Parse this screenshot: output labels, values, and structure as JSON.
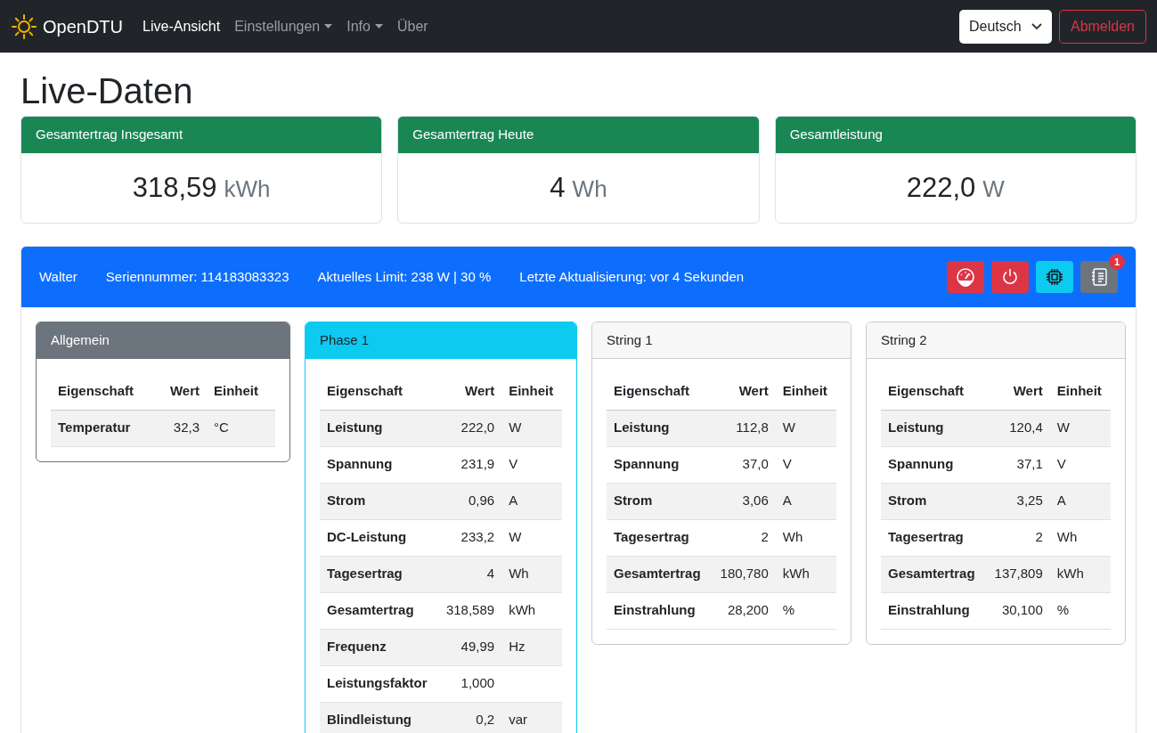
{
  "navbar": {
    "brand": "OpenDTU",
    "items": [
      {
        "label": "Live-Ansicht",
        "selected": true,
        "dropdown": false
      },
      {
        "label": "Einstellungen",
        "selected": false,
        "dropdown": true
      },
      {
        "label": "Info",
        "selected": false,
        "dropdown": true
      },
      {
        "label": "Über",
        "selected": false,
        "dropdown": false
      }
    ],
    "language": "Deutsch",
    "logout": "Abmelden"
  },
  "title": "Live-Daten",
  "totals": [
    {
      "label": "Gesamtertrag Insgesamt",
      "value": "318,59",
      "unit": "kWh"
    },
    {
      "label": "Gesamtertrag Heute",
      "value": "4",
      "unit": "Wh"
    },
    {
      "label": "Gesamtleistung",
      "value": "222,0",
      "unit": "W"
    }
  ],
  "inverter": {
    "name": "Walter",
    "serial": "Seriennummer: 114183083323",
    "limit": "Aktuelles Limit: 238 W | 30 %",
    "updated": "Letzte Aktualisierung: vor 4 Sekunden",
    "buttons": [
      {
        "kind": "gauge"
      },
      {
        "kind": "power"
      },
      {
        "kind": "chip"
      },
      {
        "kind": "log",
        "badge": "1"
      }
    ],
    "cards": [
      {
        "kind": "general",
        "title": "Allgemein",
        "columns": [
          "Eigenschaft",
          "Wert",
          "Einheit"
        ],
        "rows": [
          [
            "Temperatur",
            "32,3",
            "°C"
          ]
        ]
      },
      {
        "kind": "phase",
        "title": "Phase 1",
        "columns": [
          "Eigenschaft",
          "Wert",
          "Einheit"
        ],
        "rows": [
          [
            "Leistung",
            "222,0",
            "W"
          ],
          [
            "Spannung",
            "231,9",
            "V"
          ],
          [
            "Strom",
            "0,96",
            "A"
          ],
          [
            "DC-Leistung",
            "233,2",
            "W"
          ],
          [
            "Tagesertrag",
            "4",
            "Wh"
          ],
          [
            "Gesamtertrag",
            "318,589",
            "kWh"
          ],
          [
            "Frequenz",
            "49,99",
            "Hz"
          ],
          [
            "Leistungsfaktor",
            "1,000"
          ],
          [
            "Blindleistung",
            "0,2",
            "var"
          ]
        ]
      },
      {
        "kind": "string",
        "title": "String 1",
        "columns": [
          "Eigenschaft",
          "Wert",
          "Einheit"
        ],
        "rows": [
          [
            "Leistung",
            "112,8",
            "W"
          ],
          [
            "Spannung",
            "37,0",
            "V"
          ],
          [
            "Strom",
            "3,06",
            "A"
          ],
          [
            "Tagesertrag",
            "2",
            "Wh"
          ],
          [
            "Gesamtertrag",
            "180,780",
            "kWh"
          ],
          [
            "Einstrahlung",
            "28,200",
            "%"
          ]
        ]
      },
      {
        "kind": "string",
        "title": "String 2",
        "columns": [
          "Eigenschaft",
          "Wert",
          "Einheit"
        ],
        "rows": [
          [
            "Leistung",
            "120,4",
            "W"
          ],
          [
            "Spannung",
            "37,1",
            "V"
          ],
          [
            "Strom",
            "3,25",
            "A"
          ],
          [
            "Tagesertrag",
            "2",
            "Wh"
          ],
          [
            "Gesamtertrag",
            "137,809",
            "kWh"
          ],
          [
            "Einstrahlung",
            "30,100",
            "%"
          ]
        ]
      }
    ]
  }
}
